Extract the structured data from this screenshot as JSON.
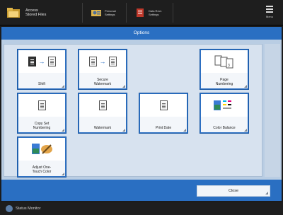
{
  "topbar": {
    "home_label_line1": "Access",
    "home_label_line2": "Stored Files",
    "btn1_line1": "Personal",
    "btn1_line2": "Settings",
    "btn2_line1": "Data Rect.",
    "btn2_line2": "Settings",
    "menu_label": "Menu"
  },
  "header": {
    "title": "Options"
  },
  "tiles": [
    {
      "label": "Shift"
    },
    {
      "label_line1": "Secure",
      "label_line2": "Watermark"
    },
    {
      "label_line1": "Page",
      "label_line2": "Numbering"
    },
    {
      "label_line1": "Copy Set",
      "label_line2": "Numbering"
    },
    {
      "label": "Watermark"
    },
    {
      "label": "Print Date"
    },
    {
      "label": "Color Balance"
    },
    {
      "label_line1": "Adjust One-",
      "label_line2": "Touch Color"
    }
  ],
  "footer": {
    "close_label": "Close"
  },
  "status": {
    "label": "Status Monitor"
  },
  "colors": {
    "accent": "#2a6fc2",
    "panel": "#d7e2ef",
    "topbar": "#1e1e1e"
  }
}
